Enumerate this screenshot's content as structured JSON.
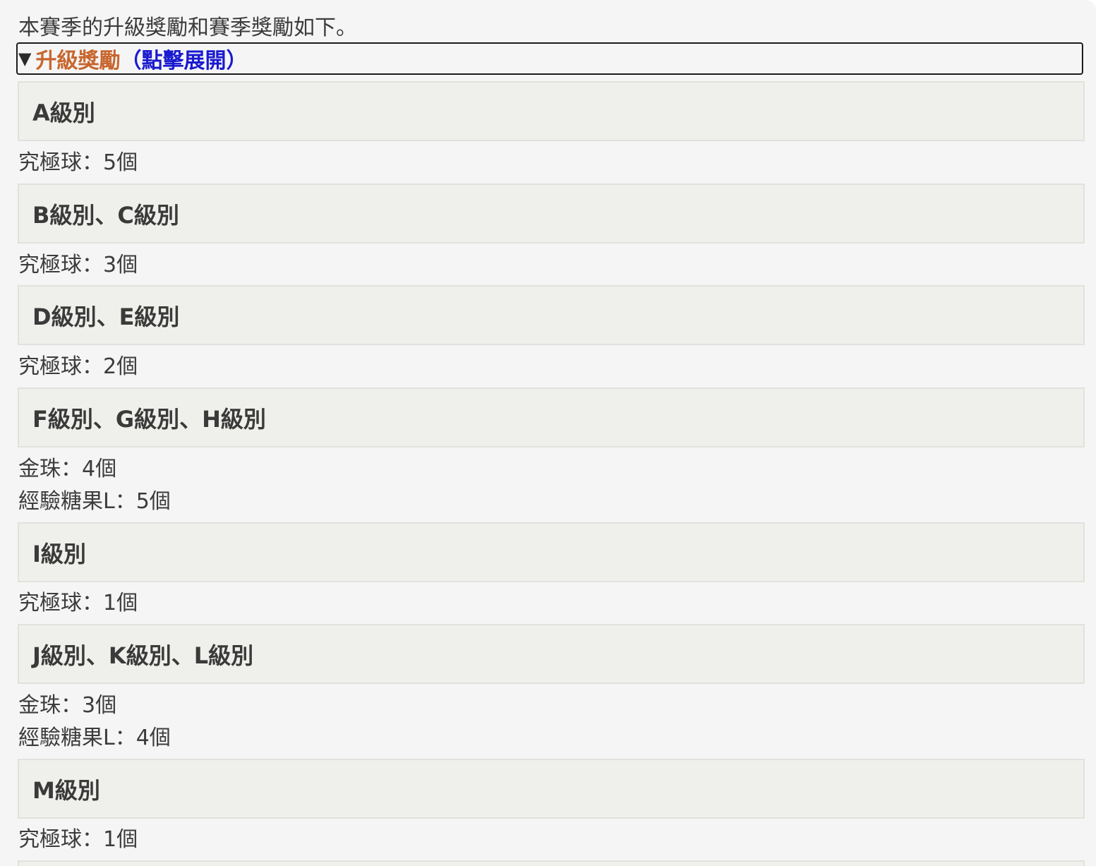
{
  "intro_text": "本賽季的升級獎勵和賽季獎勵如下。",
  "section": {
    "title": "升級獎勵",
    "hint": "（點擊展開）"
  },
  "tiers": [
    {
      "name": "A級別",
      "rewards": [
        "究極球：5個"
      ]
    },
    {
      "name": "B級別、C級別",
      "rewards": [
        "究極球：3個"
      ]
    },
    {
      "name": "D級別、E級別",
      "rewards": [
        "究極球：2個"
      ]
    },
    {
      "name": "F級別、G級別、H級別",
      "rewards": [
        "金珠：4個",
        "經驗糖果L：5個"
      ]
    },
    {
      "name": "I級別",
      "rewards": [
        "究極球：1個"
      ]
    },
    {
      "name": "J級別、K級別、L級別",
      "rewards": [
        "金珠：3個",
        "經驗糖果L：4個"
      ]
    },
    {
      "name": "M級別",
      "rewards": [
        "究極球：1個"
      ]
    }
  ],
  "colors": {
    "title": "#c8662e",
    "hint": "#1a1ad0",
    "tier_bg": "#efefeb",
    "page_bg": "#f5f5f5"
  }
}
